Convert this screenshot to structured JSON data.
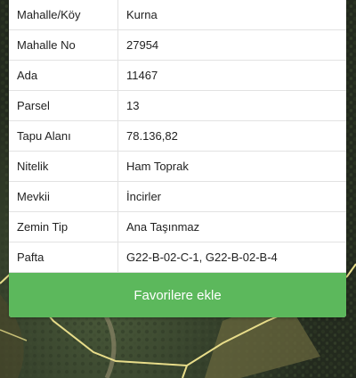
{
  "colors": {
    "button_bg": "#5cb85c",
    "button_text": "#ffffff",
    "boundary_line": "#e8dd8a"
  },
  "parcel": {
    "rows": [
      {
        "label": "Mahalle/Köy",
        "value": "Kurna"
      },
      {
        "label": "Mahalle No",
        "value": "27954"
      },
      {
        "label": "Ada",
        "value": "11467"
      },
      {
        "label": "Parsel",
        "value": "13"
      },
      {
        "label": "Tapu Alanı",
        "value": "78.136,82"
      },
      {
        "label": "Nitelik",
        "value": "Ham Toprak"
      },
      {
        "label": "Mevkii",
        "value": "İncirler"
      },
      {
        "label": "Zemin Tip",
        "value": "Ana Taşınmaz"
      },
      {
        "label": "Pafta",
        "value": "G22-B-02-C-1, G22-B-02-B-4"
      }
    ],
    "favorite_label": "Favorilere ekle"
  }
}
